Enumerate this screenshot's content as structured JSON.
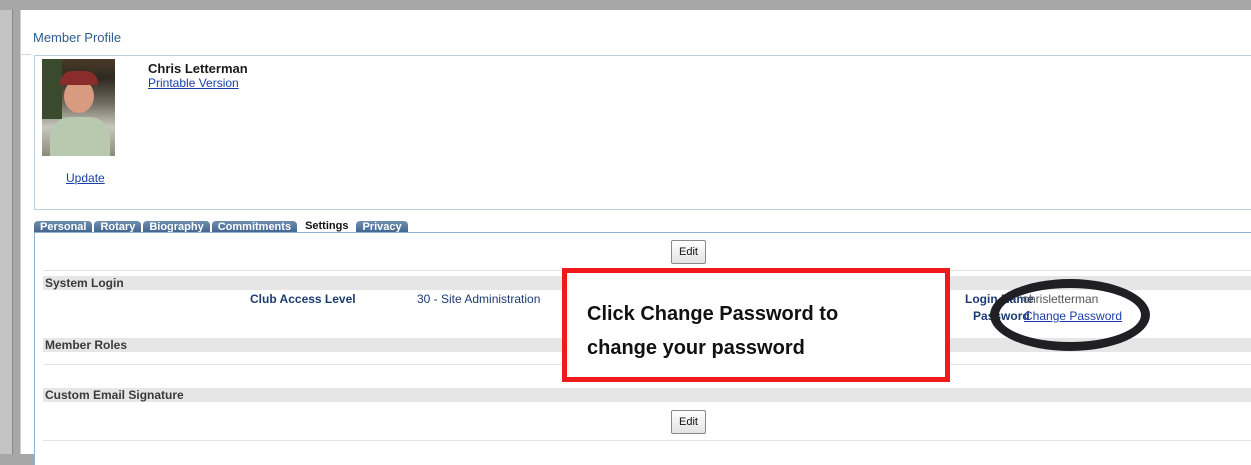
{
  "page": {
    "title": "Member Profile"
  },
  "profile": {
    "name": "Chris Letterman",
    "printable_link": "Printable Version",
    "update_link": "Update"
  },
  "tabs": [
    {
      "label": "Personal"
    },
    {
      "label": "Rotary"
    },
    {
      "label": "Biography"
    },
    {
      "label": "Commitments"
    },
    {
      "label": "Settings",
      "active": true
    },
    {
      "label": "Privacy"
    }
  ],
  "settings": {
    "edit_label": "Edit",
    "system_login": {
      "title": "System Login",
      "club_access_label": "Club Access Level",
      "club_access_value": "30 - Site Administration",
      "login_name_label": "Login Name",
      "login_name_value": "chrisletterman",
      "password_label": "Password",
      "change_password_link": "Change Password"
    },
    "member_roles": {
      "title": "Member Roles"
    },
    "custom_email_signature": {
      "title": "Custom Email Signature",
      "edit_label": "Edit"
    }
  },
  "callout": {
    "line1": "Click Change Password to",
    "line2": "change your password"
  },
  "colors": {
    "callout_border": "#ef1a1a",
    "highlight_ellipse": "#1f1f24",
    "tab_bg": "#3f638c",
    "link": "#1a3ea8"
  }
}
